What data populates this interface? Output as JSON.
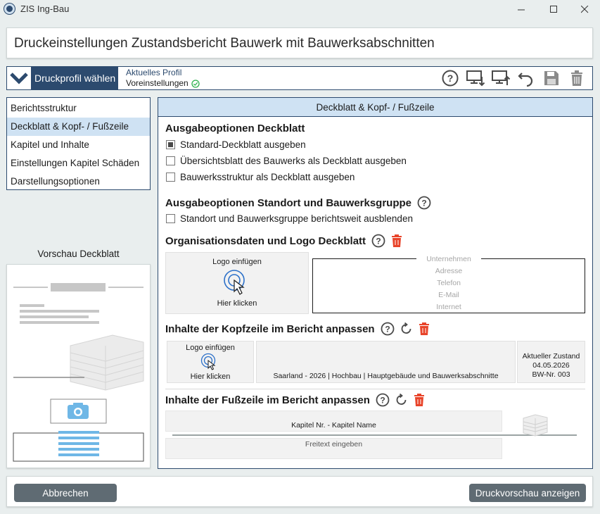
{
  "window": {
    "title": "ZIS Ing-Bau"
  },
  "header": {
    "title": "Druckeinstellungen Zustandsbericht Bauwerk mit Bauwerksabschnitten"
  },
  "profile": {
    "button_label": "Druckprofil wählen",
    "current_label": "Aktuelles Profil",
    "current_value": "Voreinstellungen"
  },
  "toolbar": {
    "icons": [
      "help-icon",
      "download-profile-icon",
      "upload-profile-icon",
      "undo-icon",
      "save-icon",
      "delete-icon"
    ]
  },
  "nav": {
    "items": [
      {
        "label": "Berichtsstruktur"
      },
      {
        "label": "Deckblatt & Kopf- / Fußzeile"
      },
      {
        "label": "Kapitel und Inhalte"
      },
      {
        "label": "Einstellungen Kapitel Schäden"
      },
      {
        "label": "Darstellungsoptionen"
      }
    ]
  },
  "preview": {
    "title": "Vorschau Deckblatt"
  },
  "main": {
    "panel_title": "Deckblatt & Kopf- / Fußzeile",
    "cover_options": {
      "title": "Ausgabeoptionen Deckblatt",
      "options": [
        {
          "label": "Standard-Deckblatt ausgeben",
          "checked": true
        },
        {
          "label": "Übersichtsblatt des Bauwerks als Deckblatt ausgeben",
          "checked": false
        },
        {
          "label": "Bauwerksstruktur als Deckblatt ausgeben",
          "checked": false
        }
      ]
    },
    "location_options": {
      "title": "Ausgabeoptionen Standort und Bauwerksgruppe",
      "option": {
        "label": "Standort und Bauwerksgruppe berichtsweit ausblenden",
        "checked": false
      }
    },
    "org_data": {
      "title": "Organisationsdaten und Logo Deckblatt",
      "logo_insert": "Logo einfügen",
      "logo_click": "Hier klicken",
      "fields": [
        "Unternehmen",
        "Adresse",
        "Telefon",
        "E-Mail",
        "Internet"
      ]
    },
    "header_content": {
      "title": "Inhalte der Kopfzeile im Bericht anpassen",
      "logo_insert": "Logo einfügen",
      "logo_click": "Hier klicken",
      "center_text": "Saarland - 2026 | Hochbau | Hauptgebäude und Bauwerksabschnitte",
      "right_line1": "Aktueller Zustand",
      "right_line2": "04.05.2026",
      "right_line3": "BW-Nr. 003"
    },
    "footer_content": {
      "title": "Inhalte der Fußzeile im Bericht anpassen",
      "line1": "Kapitel Nr. - Kapitel Name",
      "free_text_placeholder": "Freitext eingeben"
    }
  },
  "buttons": {
    "cancel": "Abbrechen",
    "print_preview": "Druckvorschau anzeigen"
  },
  "colors": {
    "accent": "#2c4a6e",
    "selection": "#cfe2f3",
    "danger": "#e8442a",
    "success": "#2bb24c",
    "button": "#5f6b73"
  }
}
